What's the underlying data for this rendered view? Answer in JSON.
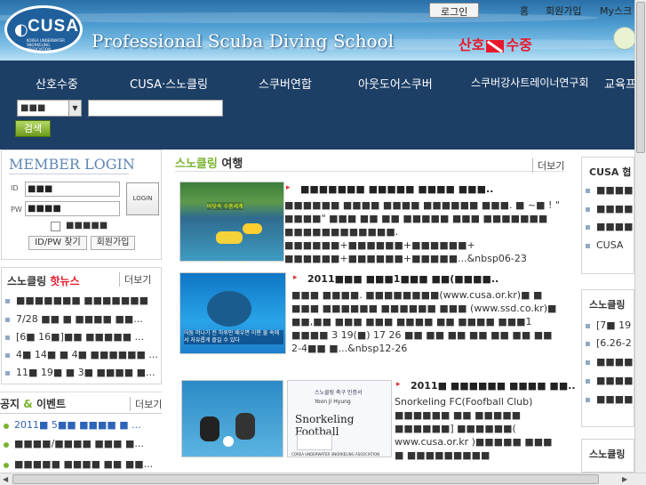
{
  "header": {
    "logo_text": "CUSA",
    "logo_sub": "KOREA UNDERWATER SNORKELING ASSOCIATION",
    "school": "Professional Scuba Diving School",
    "login": "로그인",
    "links": [
      "홈",
      "회원가입",
      "My스크"
    ],
    "sanho_left": "산호",
    "sanho_right": "수중"
  },
  "nav": {
    "items": [
      "산호수중",
      "CUSA·스노클링",
      "스쿠버연합",
      "아웃도어스쿠버",
      "스쿠버강사트레이너연구회",
      "교육프"
    ]
  },
  "search": {
    "select_value": "■■■",
    "button": "검색"
  },
  "member": {
    "title": "MEMBER LOGIN",
    "id_label": "ID",
    "pw_label": "PW",
    "id_value": "■■■",
    "pw_value": "■■■■",
    "login_btn": "LOGIN",
    "save_label": "■■■■■",
    "find_btn": "ID/PW 찾기",
    "join_btn": "회원가입"
  },
  "snorkel_news": {
    "title_a": "스노클링",
    "title_b": "핫뉴스",
    "more": "더보기",
    "items": [
      "■■■■■■■ ■■■■■■■",
      "7/28 ■■ ■ ■■■■ ■■...",
      "[6■ 16■]■■ ■■■■■ ...",
      "4■ 14■ ■ 4■ ■■■■■■ ...",
      "11■ 19■ ■ 3■ ■■■■ ■..."
    ]
  },
  "notice": {
    "title_a": "공지",
    "title_amp": "&",
    "title_b": "이벤트",
    "more": "더보기",
    "items": [
      "2011■ 5■■ ■■■■ ■ ...",
      "■■■■/■■■■ ■■■ ■...",
      "■■■■■ ■■■■ ■■ ■■..."
    ]
  },
  "travel": {
    "title_a": "스노클링",
    "title_b": "여행",
    "more": "더보기",
    "posts": [
      {
        "title": "■■■■■■■ ■■■■■ ■■■■ ■■■..",
        "body": "■■■■■■ ■■■■ ■■■■ ■■■■■■ ■■■. ■ ~■ ! \" ■■■■\" ■■■ ■■ ■■ ■■■■■ ■■■ ■■■■■■■ ■■■■■■■■■■■■. ■■■■■■+■■■■■■+■■■■■■+ ■■■■■■+■■■■■■+■■■■■...&nbsp06-23",
        "img_caption": "바닷속 수중세계"
      },
      {
        "title": "2011■■■ ■■■1■■■ ■■(■■■■..",
        "body": "■■■ ■■■■. ■■■■■■■■(www.cusa.or.kr)■ ■ ■■■ ■■■■■■ ■■■■■■ ■■■ (www.ssd.co.kr)■ ■■,■■ ■■■ ■■■ ■■■■ ■■ ■■■■ ■■■1 ■■■■ 3 19(■) 17 26 ■■ ■■ ■■ ■■ ■■ ■■ ■■ 2-4■■ ■...&nbsp12-26",
        "img_caption": "어둠 머나기 전 하루만 배우면 이젠 물 속에서 자유롭게 즐길 수 있다"
      },
      {
        "title": "2011■ ■■■■■■ ■■■■ ■■..",
        "body": "Snorkeling FC(Foofball Club) ■■■■■■ ■■ ■■■■■ ■■■■■■] ■■■■■■( www.cusa.or.kr )■■■■■ ■■■ ■ ■■■■■■■■■",
        "img_caption": "Snorkeling Football",
        "poster_top": "스노클링 축구 인증서",
        "poster_name": "Yoon Ji Hyung",
        "poster_bottom": "COREA UNDERWATER SNORKELING ASSOCIATION"
      }
    ]
  },
  "right": {
    "box1_title": "CUSA 협",
    "box1_items": [
      "■■■■",
      "■■■■",
      "■■■■",
      "CUSA"
    ],
    "box2_title": "스노클링",
    "box2_items": [
      "[7■ 19",
      "[6.26-2",
      "■■■■",
      "■■■■",
      "■■■■"
    ],
    "box3_title": "스노클링"
  },
  "colors": {
    "nav_bg": "#1d3f66",
    "accent_green": "#7ab32e",
    "accent_red": "#e8192c",
    "title_blue": "#5e86b4"
  }
}
